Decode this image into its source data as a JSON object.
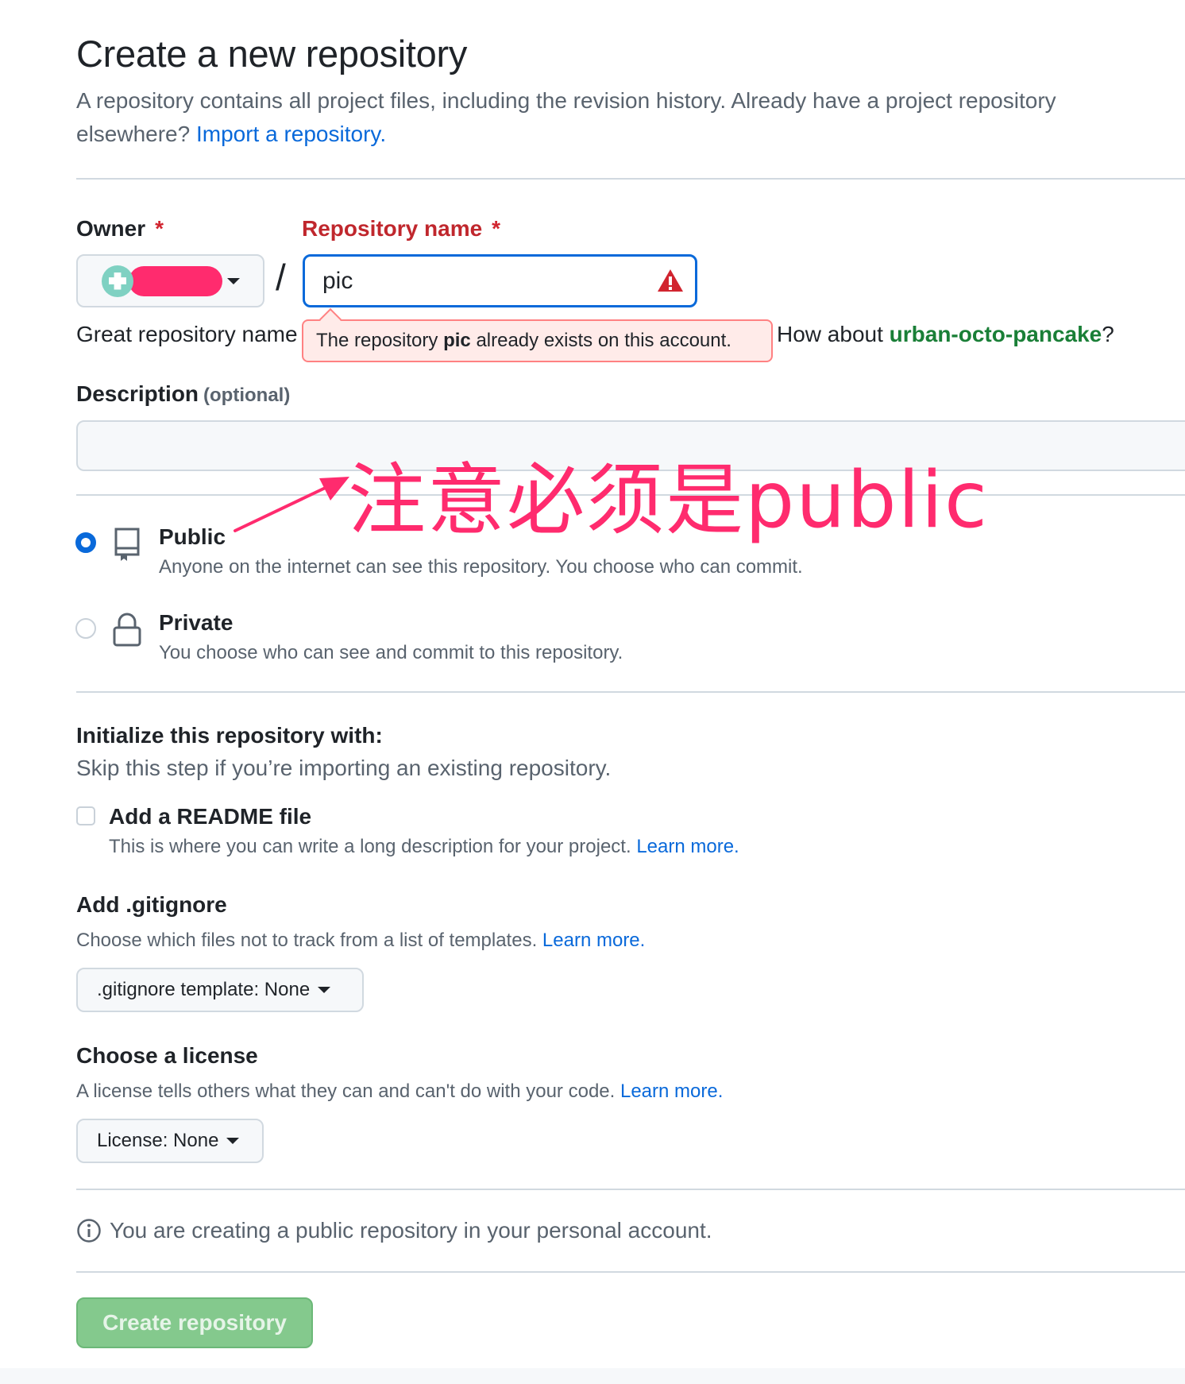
{
  "header": {
    "title": "Create a new repository",
    "subtitle": "A repository contains all project files, including the revision history. Already have a project repository elsewhere?",
    "import_link": "Import a repository."
  },
  "owner": {
    "label": "Owner",
    "required_mark": "*",
    "avatar_icon": "avatar-icon"
  },
  "repo": {
    "label": "Repository name",
    "required_mark": "*",
    "separator": "/",
    "value": "pic",
    "warning_icon": "alert-triangle-icon",
    "hint_prefix": "Great repository name",
    "error_prefix": "The repository",
    "error_name": "pic",
    "error_suffix": "already exists on this account.",
    "suggest_prefix": "How about",
    "suggestion": "urban-octo-pancake",
    "suggest_suffix": "?"
  },
  "description": {
    "label": "Description",
    "optional": "(optional)",
    "value": ""
  },
  "visibility": {
    "public": {
      "title": "Public",
      "desc": "Anyone on the internet can see this repository. You choose who can commit.",
      "checked": true,
      "icon": "repo-icon"
    },
    "private": {
      "title": "Private",
      "desc": "You choose who can see and commit to this repository.",
      "checked": false,
      "icon": "lock-icon"
    }
  },
  "init": {
    "title": "Initialize this repository with:",
    "subtitle": "Skip this step if you’re importing an existing repository.",
    "readme_label": "Add a README file",
    "readme_desc": "This is where you can write a long description for your project.",
    "readme_link": "Learn more."
  },
  "gitignore": {
    "title": "Add .gitignore",
    "desc": "Choose which files not to track from a list of templates.",
    "link": "Learn more.",
    "button": ".gitignore template: None"
  },
  "license": {
    "title": "Choose a license",
    "desc": "A license tells others what they can and can't do with your code.",
    "link": "Learn more.",
    "button": "License: None"
  },
  "info": {
    "text": "You are creating a public repository in your personal account.",
    "icon": "info-icon"
  },
  "submit": {
    "label": "Create repository"
  },
  "annotation": {
    "text": "注意必须是public",
    "color": "#ff2b6e"
  },
  "colors": {
    "accent": "#0969da",
    "error": "#c0272d",
    "success": "#1a7f37",
    "button_disabled": "#84c98d"
  }
}
